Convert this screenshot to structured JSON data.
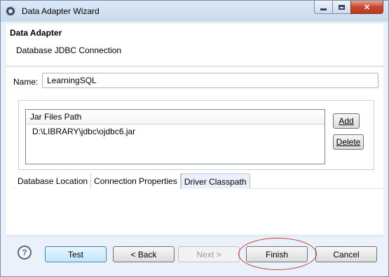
{
  "window": {
    "title": "Data Adapter Wizard",
    "icon": "eclipse-app-icon",
    "controls": {
      "minimize": "minimize-icon",
      "maximize": "maximize-icon",
      "close": "close-icon"
    }
  },
  "header": {
    "title": "Data Adapter",
    "subtitle": "Database JDBC Connection"
  },
  "form": {
    "name_label": "Name:",
    "name_value": "LearningSQL"
  },
  "jar_table": {
    "column_header": "Jar Files Path",
    "rows": [
      "D:\\LIBRARY\\jdbc\\ojdbc6.jar"
    ]
  },
  "side_buttons": {
    "add_label": "Add",
    "delete_label": "Delete"
  },
  "tabs": [
    {
      "label": "Database Location",
      "active": false
    },
    {
      "label": "Connection Properties",
      "active": false
    },
    {
      "label": "Driver Classpath",
      "active": true
    }
  ],
  "footer": {
    "help_glyph": "?",
    "test_label": "Test",
    "back_label": "< Back",
    "next_label": "Next >",
    "finish_label": "Finish",
    "cancel_label": "Cancel"
  },
  "colors": {
    "highlight_ring": "#c0392b",
    "window_bg": "#eaf1fa"
  }
}
